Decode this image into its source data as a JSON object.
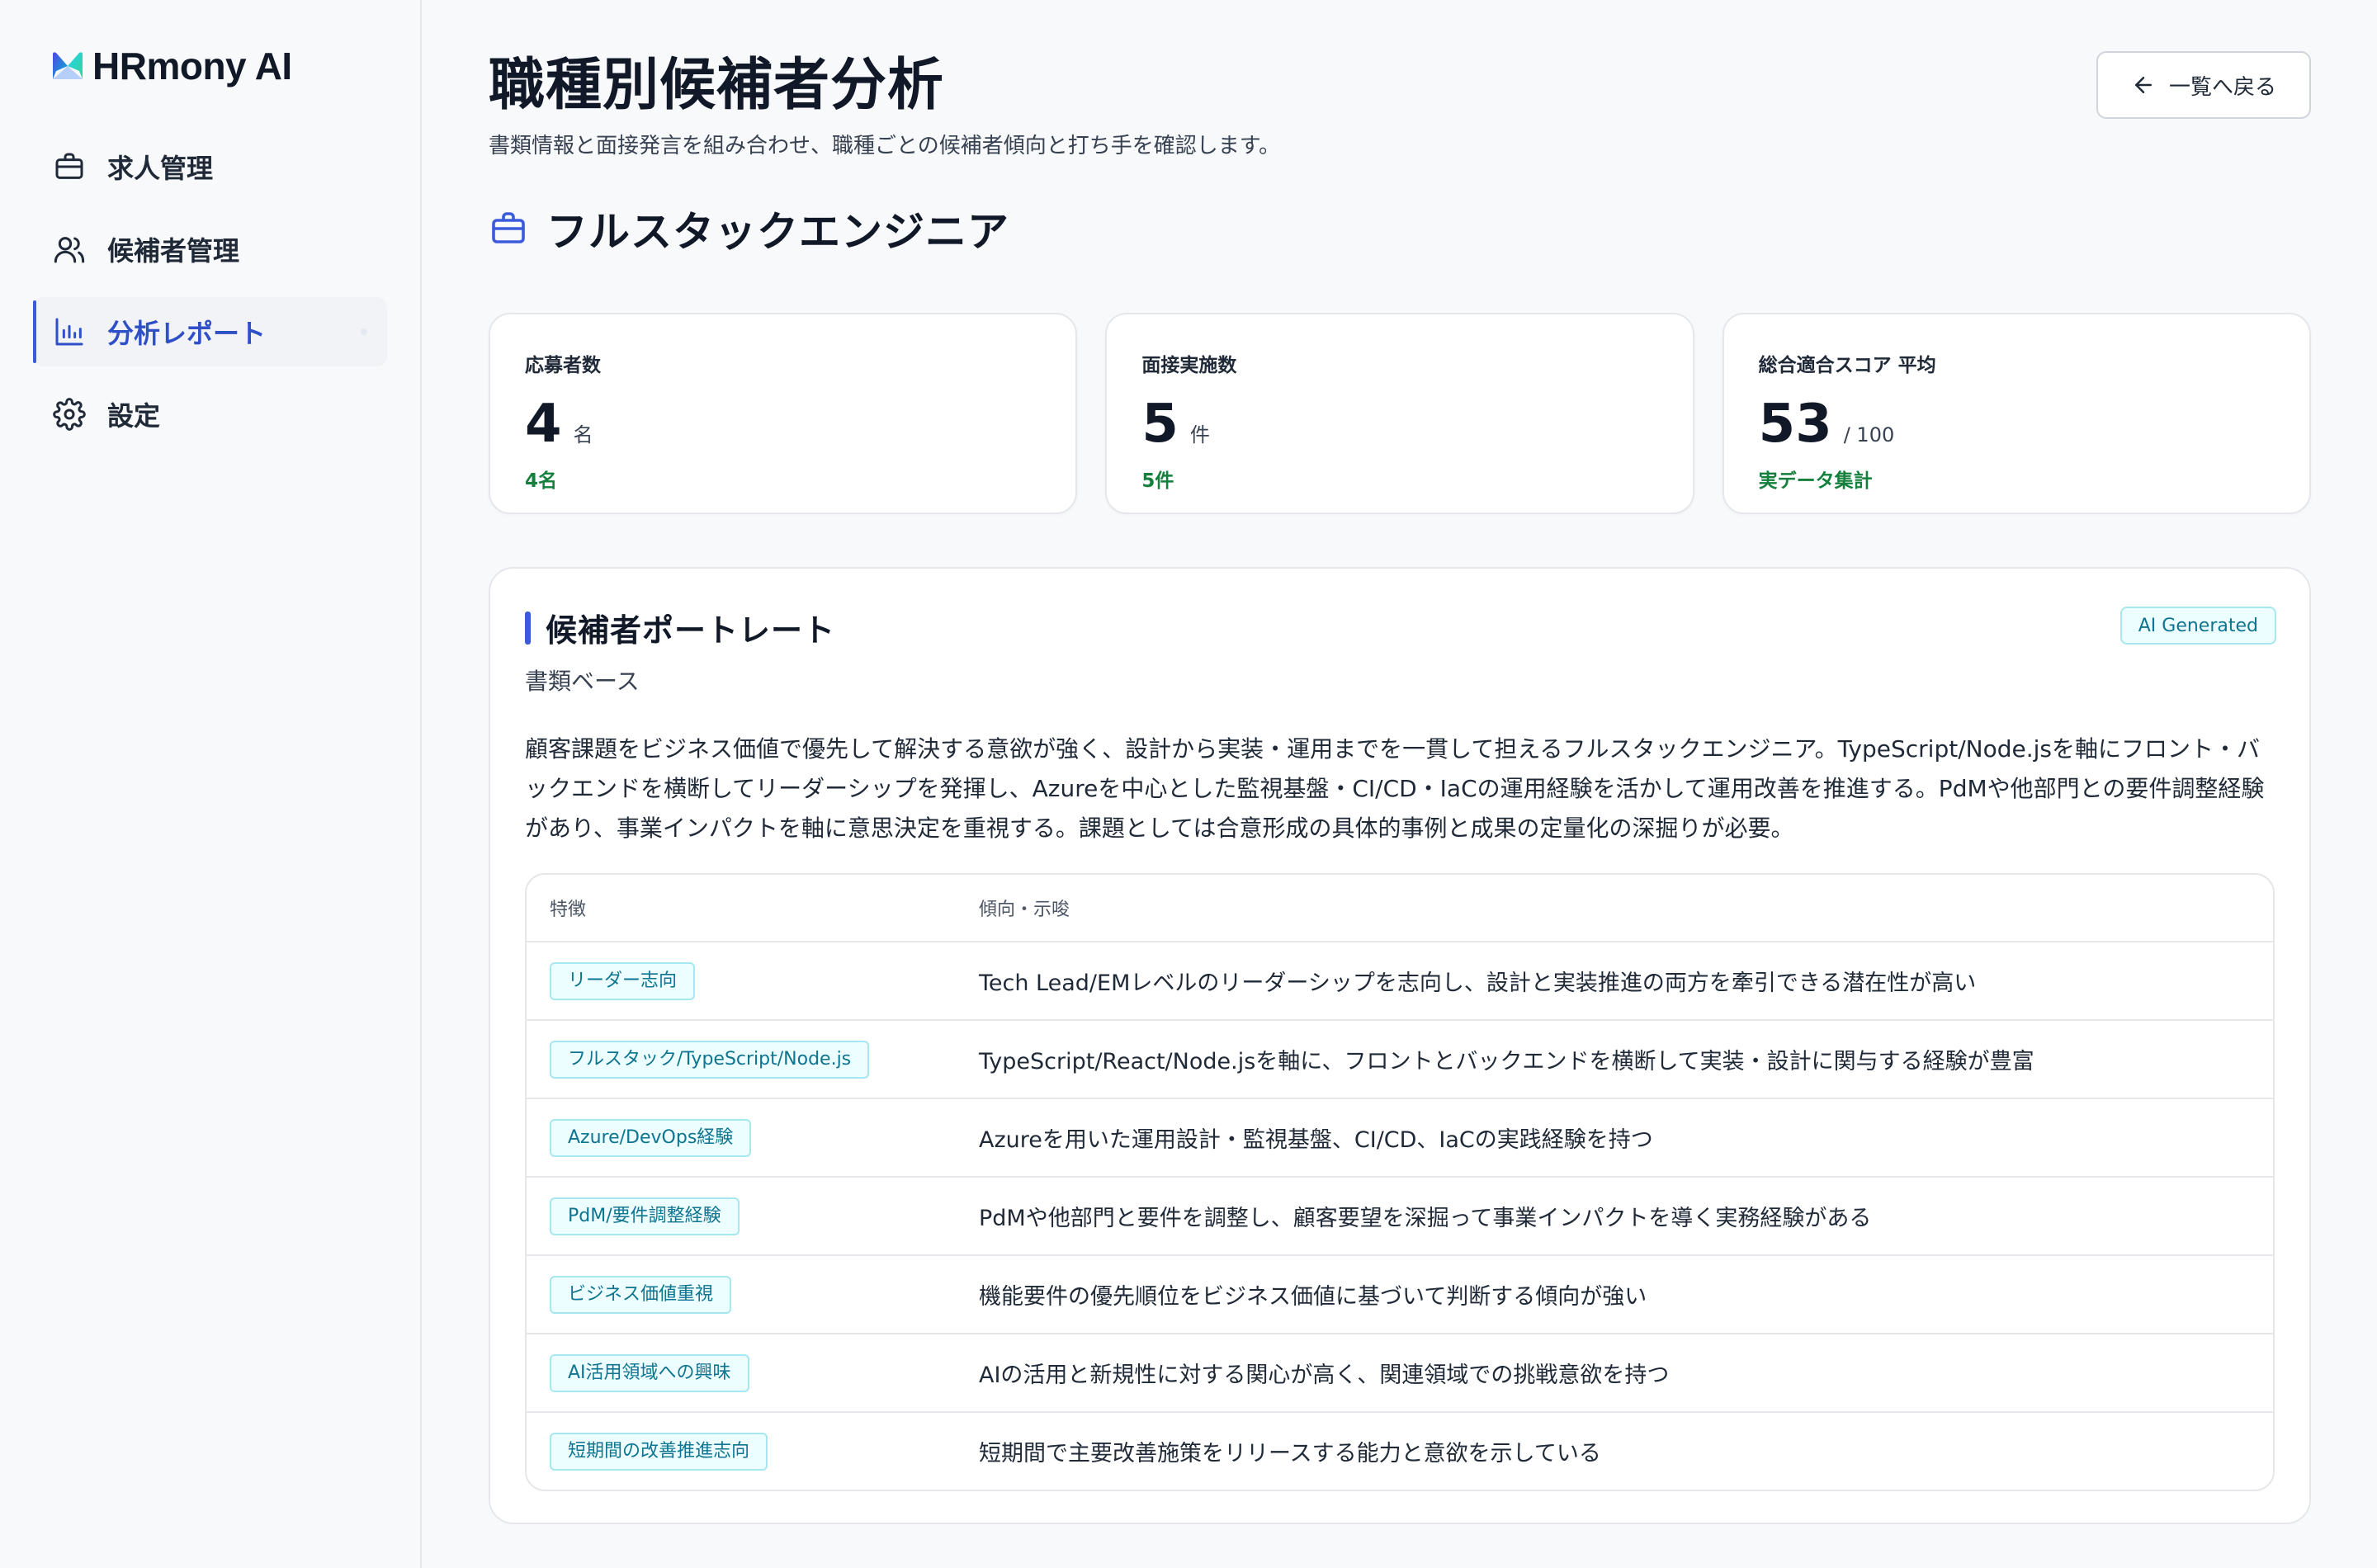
{
  "app": {
    "logo_text": "HRmony AI"
  },
  "sidebar": {
    "items": [
      {
        "label": "求人管理",
        "icon": "briefcase-icon",
        "active": false
      },
      {
        "label": "候補者管理",
        "icon": "users-icon",
        "active": false
      },
      {
        "label": "分析レポート",
        "icon": "bar-chart-icon",
        "active": true
      },
      {
        "label": "設定",
        "icon": "gear-icon",
        "active": false
      }
    ]
  },
  "header": {
    "title": "職種別候補者分析",
    "subtitle": "書類情報と面接発言を組み合わせ、職種ごとの候補者傾向と打ち手を確認します。",
    "back_label": "一覧へ戻る"
  },
  "job": {
    "title": "フルスタックエンジニア"
  },
  "stats": [
    {
      "label": "応募者数",
      "value": "4",
      "unit": "名",
      "note": "4名"
    },
    {
      "label": "面接実施数",
      "value": "5",
      "unit": "件",
      "note": "5件"
    },
    {
      "label": "総合適合スコア 平均",
      "value": "53",
      "unit": "/ 100",
      "note": "実データ集計"
    }
  ],
  "portrait": {
    "title": "候補者ポートレート",
    "badge": "AI Generated",
    "subtitle": "書類ベース",
    "summary": "顧客課題をビジネス価値で優先して解決する意欲が強く、設計から実装・運用までを一貫して担えるフルスタックエンジニア。TypeScript/Node.jsを軸にフロント・バックエンドを横断してリーダーシップを発揮し、Azureを中心とした監視基盤・CI/CD・IaCの運用経験を活かして運用改善を推進する。PdMや他部門との要件調整経験があり、事業インパクトを軸に意思決定を重視する。課題としては合意形成の具体的事例と成果の定量化の深掘りが必要。",
    "table": {
      "headers": [
        "特徴",
        "傾向・示唆"
      ],
      "rows": [
        {
          "tag": "リーダー志向",
          "desc": "Tech Lead/EMレベルのリーダーシップを志向し、設計と実装推進の両方を牽引できる潜在性が高い"
        },
        {
          "tag": "フルスタック/TypeScript/Node.js",
          "desc": "TypeScript/React/Node.jsを軸に、フロントとバックエンドを横断して実装・設計に関与する経験が豊富"
        },
        {
          "tag": "Azure/DevOps経験",
          "desc": "Azureを用いた運用設計・監視基盤、CI/CD、IaCの実践経験を持つ"
        },
        {
          "tag": "PdM/要件調整経験",
          "desc": "PdMや他部門と要件を調整し、顧客要望を深掘って事業インパクトを導く実務経験がある"
        },
        {
          "tag": "ビジネス価値重視",
          "desc": "機能要件の優先順位をビジネス価値に基づいて判断する傾向が強い"
        },
        {
          "tag": "AI活用領域への興味",
          "desc": "AIの活用と新規性に対する関心が高く、関連領域での挑戦意欲を持つ"
        },
        {
          "tag": "短期間の改善推進志向",
          "desc": "短期間で主要改善施策をリリースする能力と意欲を示している"
        }
      ]
    }
  },
  "colors": {
    "accent": "#3b5bdb",
    "positive": "#15803d",
    "tag_bg": "#ecfeff",
    "tag_text": "#0e7490"
  }
}
